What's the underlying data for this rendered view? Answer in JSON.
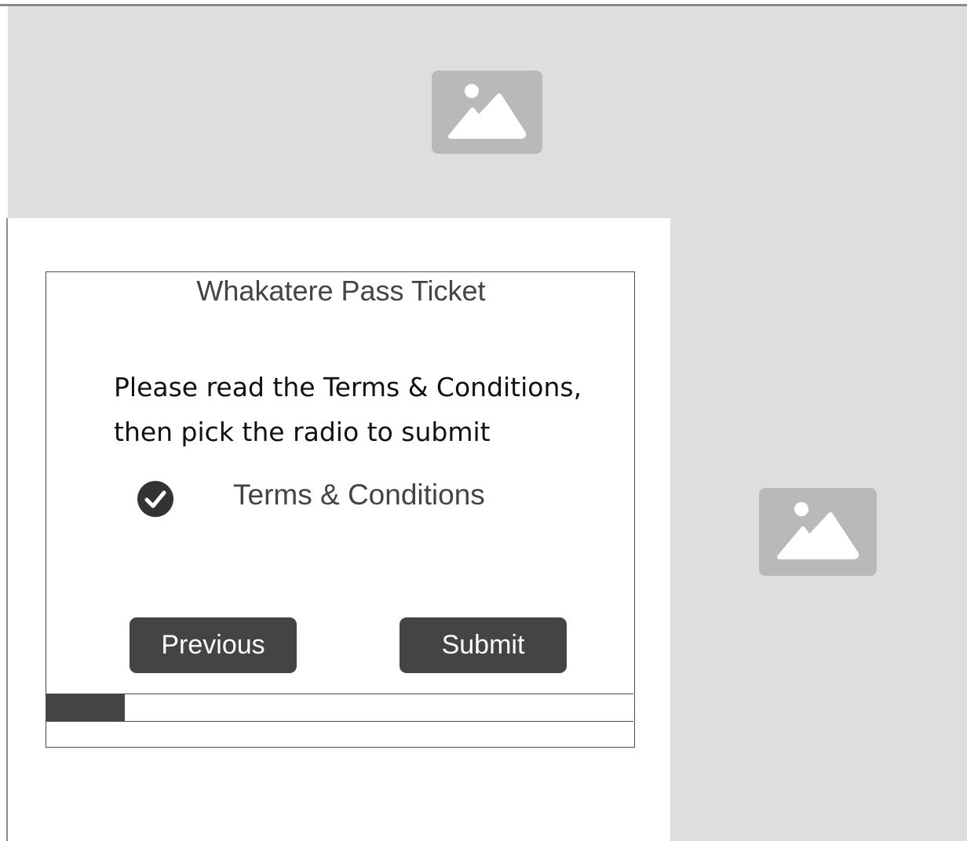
{
  "hero": {
    "image_icon": "image-placeholder-icon"
  },
  "side": {
    "image_icon": "image-placeholder-icon"
  },
  "form": {
    "title": "Whakatere Pass Ticket",
    "instruction_line1": "Please read the Terms & Conditions,",
    "instruction_line2": "then pick the radio to submit",
    "terms_label": "Terms & Conditions",
    "terms_checked": true,
    "check_icon": "check-circle-icon",
    "previous_label": "Previous",
    "submit_label": "Submit",
    "progress_fraction": 0.134
  },
  "colors": {
    "panel_gray": "#dedede",
    "placeholder_gray": "#b9b9b9",
    "button_dark": "#444444",
    "text_gray": "#444444"
  }
}
